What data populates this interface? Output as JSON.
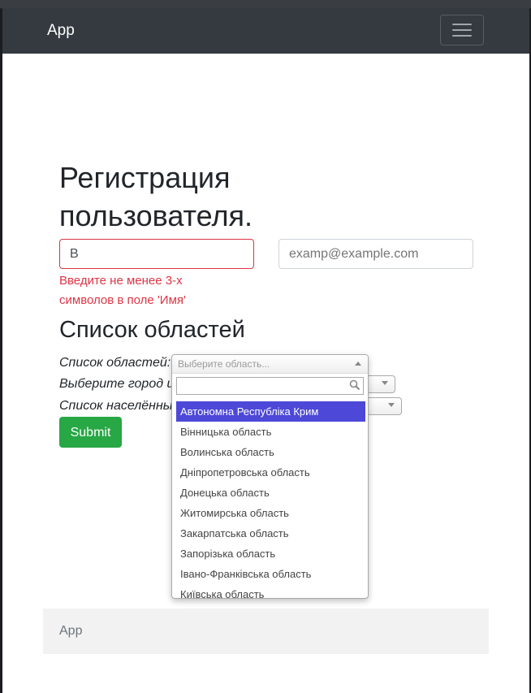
{
  "navbar": {
    "brand": "App"
  },
  "page": {
    "title": "Регистрация пользователя.",
    "name_value": "В",
    "email_placeholder": "examp@example.com",
    "name_error": "Введите не менее 3-х символов в поле 'Имя'",
    "section_heading": "Список областей",
    "label_regions": "Список областей:",
    "label_city": "Выберите город или",
    "label_settlements": "Список населённых",
    "submit_label": "Submit"
  },
  "region_select": {
    "placeholder": "Выберите область...",
    "search_value": "",
    "options": [
      "Автономна Республіка Крим",
      "Вінницька область",
      "Волинська область",
      "Дніпропетровська область",
      "Донецька область",
      "Житомирська область",
      "Закарпатська область",
      "Запорізька область",
      "Івано-Франківська область",
      "Київська область"
    ],
    "highlighted_index": 0
  },
  "footer": {
    "text": "App"
  },
  "colors": {
    "navbar": "#343a40",
    "error": "#dc3545",
    "submit": "#28a745",
    "highlight": "#4d48d8"
  },
  "icons": {
    "menu": "hamburger-icon",
    "search": "search-icon",
    "dropdown": "chevron-up-icon"
  }
}
